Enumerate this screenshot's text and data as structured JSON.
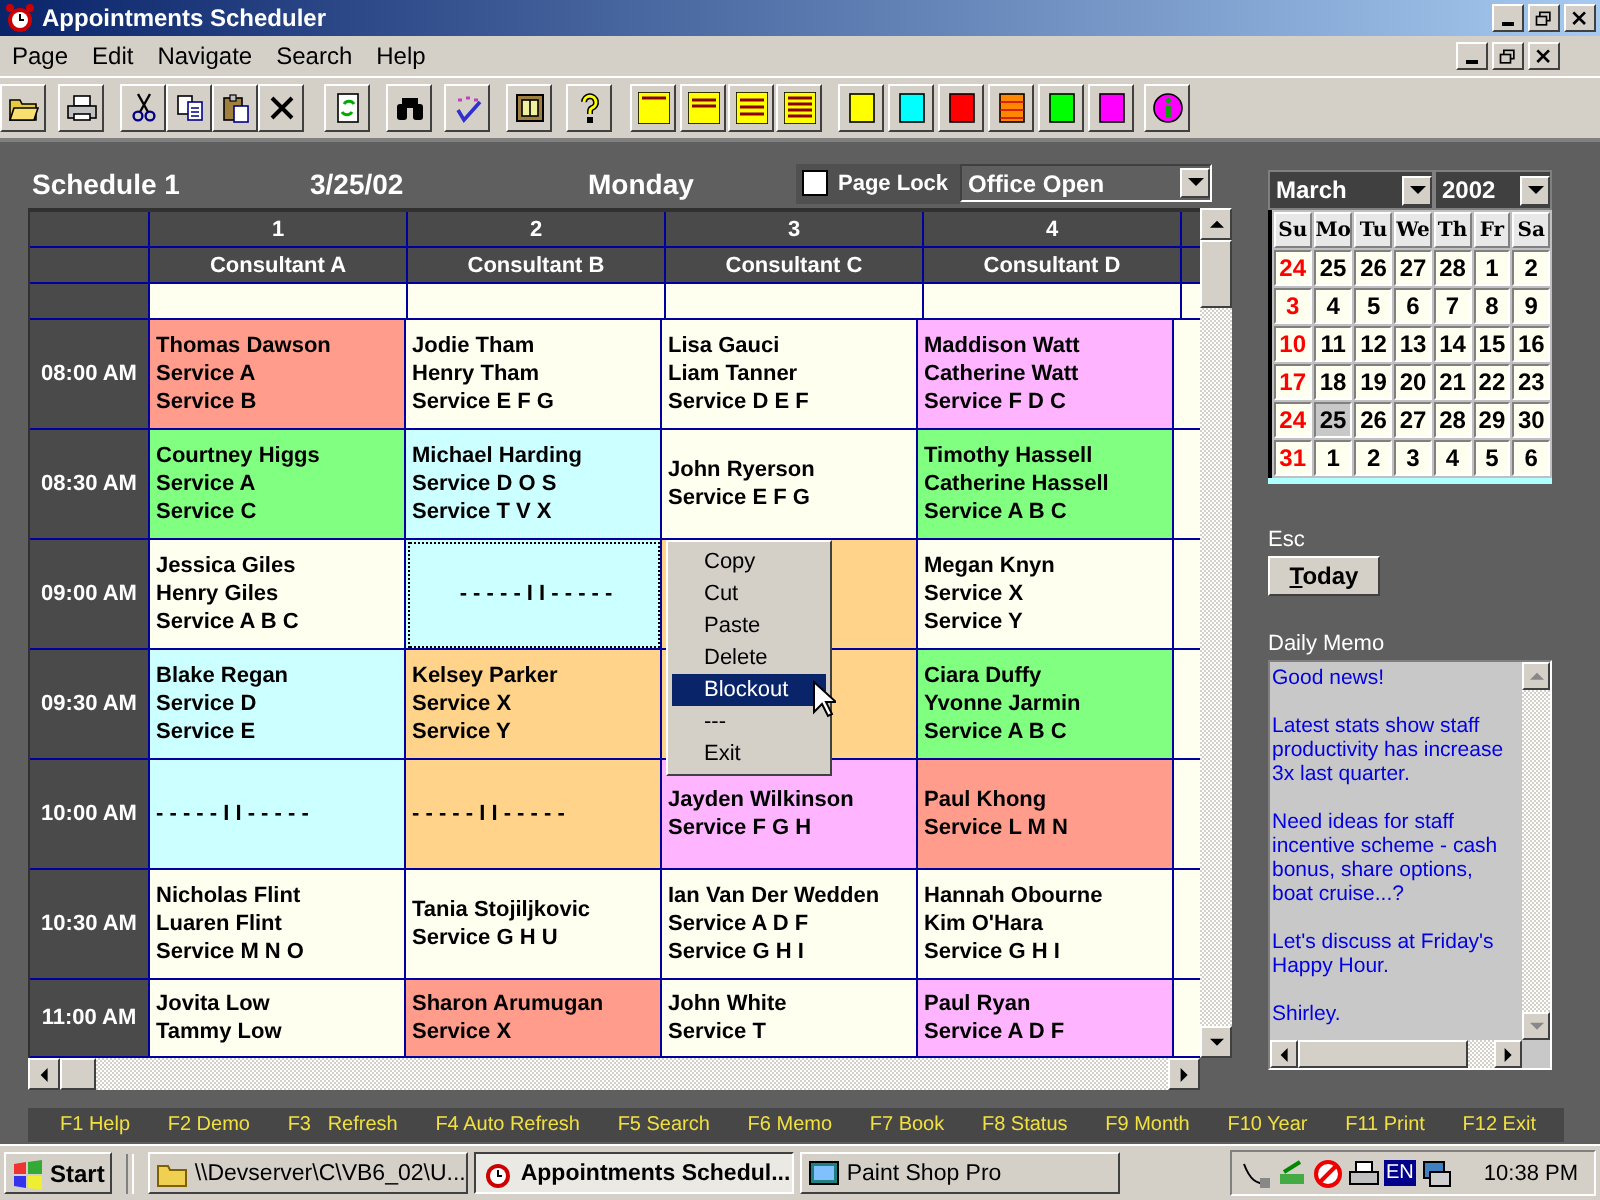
{
  "window": {
    "title": "Appointments Scheduler"
  },
  "menu": [
    "Page",
    "Edit",
    "Navigate",
    "Search",
    "Help"
  ],
  "schedule": {
    "name": "Schedule 1",
    "date": "3/25/02",
    "weekday": "Monday",
    "page_lock": {
      "label": "Page Lock",
      "checked": false
    },
    "status_select": "Office Open"
  },
  "grid": {
    "columns": [
      {
        "number": "1",
        "name": "Consultant A"
      },
      {
        "number": "2",
        "name": "Consultant B"
      },
      {
        "number": "3",
        "name": "Consultant C"
      },
      {
        "number": "4",
        "name": "Consultant D"
      }
    ],
    "rows": [
      {
        "time": "08:00 AM",
        "cells": [
          {
            "lines": [
              "Thomas Dawson",
              "Service A",
              "Service B"
            ],
            "color": "#ff9c8c",
            "selected": false
          },
          {
            "lines": [
              "Jodie Tham",
              "Henry Tham",
              "Service E F G"
            ],
            "color": "#fffff0",
            "selected": false
          },
          {
            "lines": [
              "Lisa Gauci",
              "Liam Tanner",
              "Service D E F"
            ],
            "color": "#fffff0",
            "selected": false
          },
          {
            "lines": [
              "Maddison Watt",
              "Catherine Watt",
              "Service F D C"
            ],
            "color": "#ffb4ff",
            "selected": false
          }
        ]
      },
      {
        "time": "08:30 AM",
        "cells": [
          {
            "lines": [
              "Courtney Higgs",
              "Service A",
              "Service C"
            ],
            "color": "#80ff80",
            "selected": false
          },
          {
            "lines": [
              "Michael Harding",
              "Service D O S",
              "Service T V X"
            ],
            "color": "#ccffff",
            "selected": false
          },
          {
            "lines": [
              "John Ryerson",
              "Service E F G"
            ],
            "color": "#fffff0",
            "selected": false
          },
          {
            "lines": [
              "Timothy Hassell",
              "Catherine Hassell",
              "Service A B C"
            ],
            "color": "#80ff80",
            "selected": false
          }
        ]
      },
      {
        "time": "09:00 AM",
        "cells": [
          {
            "lines": [
              "Jessica Giles",
              "Henry Giles",
              "Service A B C"
            ],
            "color": "#fffff0",
            "selected": false
          },
          {
            "lines": [
              "- - - - - I I - - - - -"
            ],
            "color": "#ccffff",
            "selected": true
          },
          {
            "color": "#ffd38a",
            "selected": false
          },
          {
            "lines": [
              "Megan Knyn",
              "Service X",
              "Service Y"
            ],
            "color": "#fffff0",
            "selected": false
          }
        ]
      },
      {
        "time": "09:30 AM",
        "cells": [
          {
            "lines": [
              "Blake Regan",
              "Service D",
              "Service E"
            ],
            "color": "#ccffff",
            "selected": false
          },
          {
            "lines": [
              "Kelsey Parker",
              "Service X",
              "Service Y"
            ],
            "color": "#ffd38a",
            "selected": false
          },
          {
            "color": "#ffd38a",
            "selected": false
          },
          {
            "lines": [
              "Ciara Duffy",
              "Yvonne Jarmin",
              "Service A B C"
            ],
            "color": "#80ff80",
            "selected": false
          }
        ]
      },
      {
        "time": "10:00 AM",
        "cells": [
          {
            "lines": [
              "- - - - - I I - - - - -"
            ],
            "color": "#ccffff",
            "selected": false
          },
          {
            "lines": [
              "- - - - - I I - - - - -"
            ],
            "color": "#ffd38a",
            "selected": false
          },
          {
            "lines": [
              "Jayden Wilkinson",
              "Service F G H"
            ],
            "color": "#ffb4ff",
            "selected": false
          },
          {
            "lines": [
              "Paul Khong",
              "Service L M N"
            ],
            "color": "#ff9c8c",
            "selected": false
          }
        ]
      },
      {
        "time": "10:30 AM",
        "cells": [
          {
            "lines": [
              "Nicholas Flint",
              "Luaren Flint",
              "Service M N O"
            ],
            "color": "#fffff0",
            "selected": false
          },
          {
            "lines": [
              "Tania Stojiljkovic",
              "Service G H U"
            ],
            "color": "#fffff0",
            "selected": false
          },
          {
            "lines": [
              "Ian Van Der Wedden",
              "Service A D F",
              "Service G H I"
            ],
            "color": "#fffff0",
            "selected": false
          },
          {
            "lines": [
              "Hannah Obourne",
              "Kim O'Hara",
              "Service G H I"
            ],
            "color": "#fffff0",
            "selected": false
          }
        ]
      },
      {
        "time": "11:00 AM",
        "cells": [
          {
            "lines": [
              "Jovita Low",
              "Tammy Low"
            ],
            "color": "#fffff0",
            "selected": false
          },
          {
            "lines": [
              "Sharon Arumugan",
              "Service X"
            ],
            "color": "#ff9c8c",
            "selected": false
          },
          {
            "lines": [
              "John White",
              "Service T"
            ],
            "color": "#fffff0",
            "selected": false
          },
          {
            "lines": [
              "Paul Ryan",
              "Service A D F"
            ],
            "color": "#ffb4ff",
            "selected": false
          }
        ]
      }
    ]
  },
  "context_menu": {
    "items": [
      {
        "label": "Copy",
        "selected": false
      },
      {
        "label": "Cut",
        "selected": false
      },
      {
        "label": "Paste",
        "selected": false
      },
      {
        "label": "Delete",
        "selected": false
      },
      {
        "label": "Blockout",
        "selected": true
      },
      {
        "label": "---",
        "selected": false
      },
      {
        "label": "Exit",
        "selected": false
      }
    ]
  },
  "calendar": {
    "month": "March",
    "year": "2002",
    "weekdays": [
      "Su",
      "Mo",
      "Tu",
      "We",
      "Th",
      "Fr",
      "Sa"
    ],
    "weeks": [
      [
        {
          "day": "24",
          "selected": false
        },
        {
          "day": "25",
          "selected": false
        },
        {
          "day": "26",
          "selected": false
        },
        {
          "day": "27",
          "selected": false
        },
        {
          "day": "28",
          "selected": false
        },
        {
          "day": "1",
          "selected": false
        },
        {
          "day": "2",
          "selected": false
        }
      ],
      [
        {
          "day": "3",
          "selected": false
        },
        {
          "day": "4",
          "selected": false
        },
        {
          "day": "5",
          "selected": false
        },
        {
          "day": "6",
          "selected": false
        },
        {
          "day": "7",
          "selected": false
        },
        {
          "day": "8",
          "selected": false
        },
        {
          "day": "9",
          "selected": false
        }
      ],
      [
        {
          "day": "10",
          "selected": false
        },
        {
          "day": "11",
          "selected": false
        },
        {
          "day": "12",
          "selected": false
        },
        {
          "day": "13",
          "selected": false
        },
        {
          "day": "14",
          "selected": false
        },
        {
          "day": "15",
          "selected": false
        },
        {
          "day": "16",
          "selected": false
        }
      ],
      [
        {
          "day": "17",
          "selected": false
        },
        {
          "day": "18",
          "selected": false
        },
        {
          "day": "19",
          "selected": false
        },
        {
          "day": "20",
          "selected": false
        },
        {
          "day": "21",
          "selected": false
        },
        {
          "day": "22",
          "selected": false
        },
        {
          "day": "23",
          "selected": false
        }
      ],
      [
        {
          "day": "24",
          "selected": false
        },
        {
          "day": "25",
          "selected": true
        },
        {
          "day": "26",
          "selected": false
        },
        {
          "day": "27",
          "selected": false
        },
        {
          "day": "28",
          "selected": false
        },
        {
          "day": "29",
          "selected": false
        },
        {
          "day": "30",
          "selected": false
        }
      ],
      [
        {
          "day": "31",
          "selected": false
        },
        {
          "day": "1",
          "selected": false
        },
        {
          "day": "2",
          "selected": false
        },
        {
          "day": "3",
          "selected": false
        },
        {
          "day": "4",
          "selected": false
        },
        {
          "day": "5",
          "selected": false
        },
        {
          "day": "6",
          "selected": false
        }
      ]
    ]
  },
  "esc_label": "Esc",
  "today_button": "Today",
  "memo": {
    "title": "Daily Memo",
    "paragraphs": [
      [
        "Good news!"
      ],
      [
        "Latest stats show staff",
        "productivity has increase",
        "3x last quarter."
      ],
      [
        "Need ideas for staff",
        "incentive scheme - cash",
        "bonus, share options,",
        "boat cruise...?"
      ],
      [
        "Let's discuss at Friday's",
        "Happy Hour."
      ],
      [
        "Shirley."
      ]
    ]
  },
  "function_keys": [
    "F1 Help",
    "F2 Demo",
    "F3   Refresh",
    "F4 Auto Refresh",
    "F5 Search",
    "F6 Memo",
    "F7 Book",
    "F8 Status",
    "F9 Month",
    "F10 Year",
    "F11 Print",
    "F12 Exit"
  ],
  "taskbar": {
    "start": "Start",
    "tasks": [
      {
        "label": "\\\\Devserver\\C\\VB6_02\\U...",
        "selected": false,
        "kind": "folder"
      },
      {
        "label": "Appointments Schedul...",
        "selected": true,
        "kind": "clock"
      },
      {
        "label": "Paint Shop Pro",
        "selected": false,
        "kind": "paint"
      }
    ],
    "language": "EN",
    "clock": "10:38 PM"
  }
}
